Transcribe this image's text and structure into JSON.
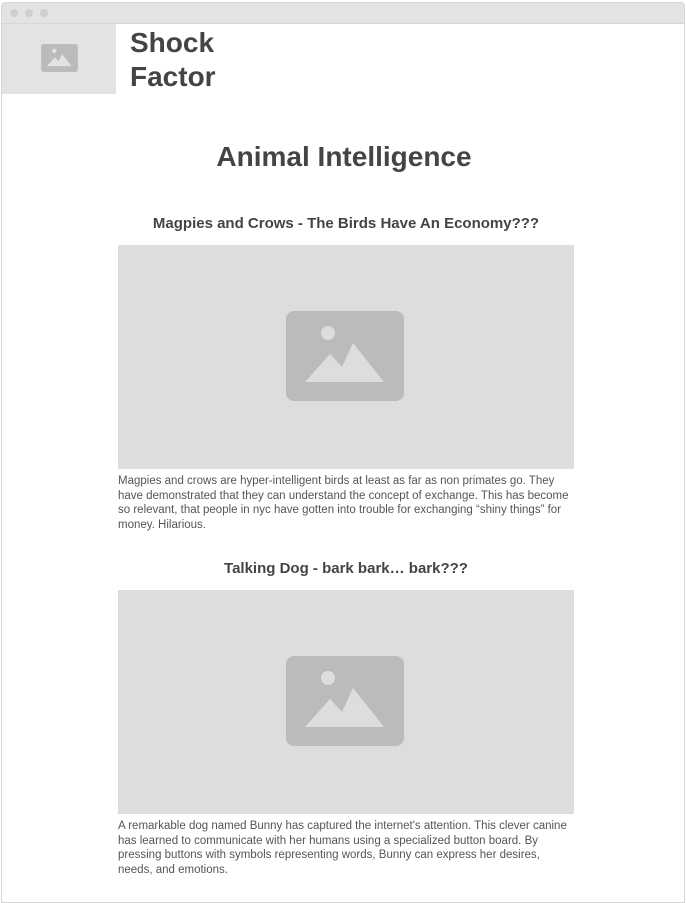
{
  "site": {
    "title": "Shock Factor"
  },
  "page": {
    "title": "Animal Intelligence"
  },
  "articles": [
    {
      "heading": "Magpies and Crows - The Birds Have An Economy???",
      "body": "Magpies and crows are hyper-intelligent birds at least as far as non primates go. They have demonstrated that they can understand the concept of exchange. This has become so relevant, that people in nyc have gotten into trouble for exchanging “shiny things” for money. Hilarious.",
      "image_icon": "image-placeholder-icon"
    },
    {
      "heading": "Talking Dog - bark bark… bark???",
      "body": "A remarkable dog named Bunny has captured the internet's attention. This clever canine has learned to communicate with her humans using a specialized button board. By pressing buttons with symbols representing words, Bunny can express her desires, needs, and emotions.",
      "image_icon": "image-placeholder-icon"
    }
  ],
  "colors": {
    "placeholder_bg": "#dddddd",
    "placeholder_icon": "#bbbbbb",
    "text": "#444444"
  }
}
